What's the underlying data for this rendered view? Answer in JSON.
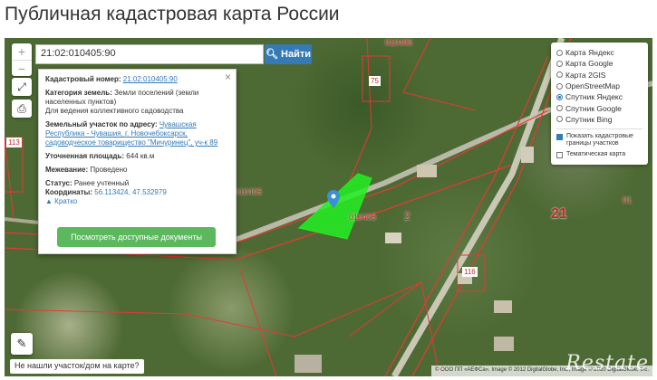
{
  "page": {
    "title": "Публичная кадастровая карта России"
  },
  "search": {
    "value": "21:02:010405:90",
    "button_label": "Найти"
  },
  "map_controls": {
    "zoom_in": "+",
    "zoom_out": "−"
  },
  "popup": {
    "close": "×",
    "cadastral_number_label": "Кадастровый номер:",
    "cadastral_number_value": "21:02:010405:90",
    "land_category_label": "Категория земель:",
    "land_category_value": "Земли поселений (земли населенных пунктов)",
    "land_use": "Для ведения коллективного садоводства",
    "address_label": "Земельный участок по адресу:",
    "address_value": "Чувашская Республика - Чувашия, г. Новочебоксарск, садоводческое товарищество \"Мичуринец\", уч-к 89",
    "area_label": "Уточненная площадь:",
    "area_value": "644 кв.м",
    "survey_label": "Межевание:",
    "survey_value": "Проведено",
    "status_label": "Статус:",
    "status_value": "Ранее учтенный",
    "coords_label": "Координаты:",
    "coords_value": "56.113424, 47.532979",
    "collapse_link": "Кратко",
    "docs_button": "Посмотреть доступные документы"
  },
  "layers": {
    "options": [
      {
        "label": "Карта Яндекс",
        "selected": false
      },
      {
        "label": "Карта Google",
        "selected": false
      },
      {
        "label": "Карта 2GIS",
        "selected": false
      },
      {
        "label": "OpenStreetMap",
        "selected": false
      },
      {
        "label": "Спутник Яндекс",
        "selected": true
      },
      {
        "label": "Спутник Google",
        "selected": false
      },
      {
        "label": "Спутник Bing",
        "selected": false
      }
    ],
    "checkboxes": [
      {
        "label": "Показать кадастровые границы участков",
        "checked": true
      },
      {
        "label": "Тематическая карта",
        "checked": false
      }
    ]
  },
  "not_found": "Не нашли участок/дом на карте?",
  "attribution": "© ООО ПП «АЕФСа», Image © 2012 DigitalGlobe, Inc., Image © 2020 DigitalGlobe, Inc.",
  "watermark": "Restate",
  "map_labels": {
    "l1": "010405",
    "l2": "75",
    "l3": "113",
    "l4": "010405",
    "l5": "010405",
    "l6": "2",
    "l7": "21",
    "l8": "116",
    "l9": "01"
  },
  "colors": {
    "accent": "#337ab7",
    "parcel": "#22ee22",
    "boundary": "#e53935",
    "docs_button": "#5cb85c"
  }
}
